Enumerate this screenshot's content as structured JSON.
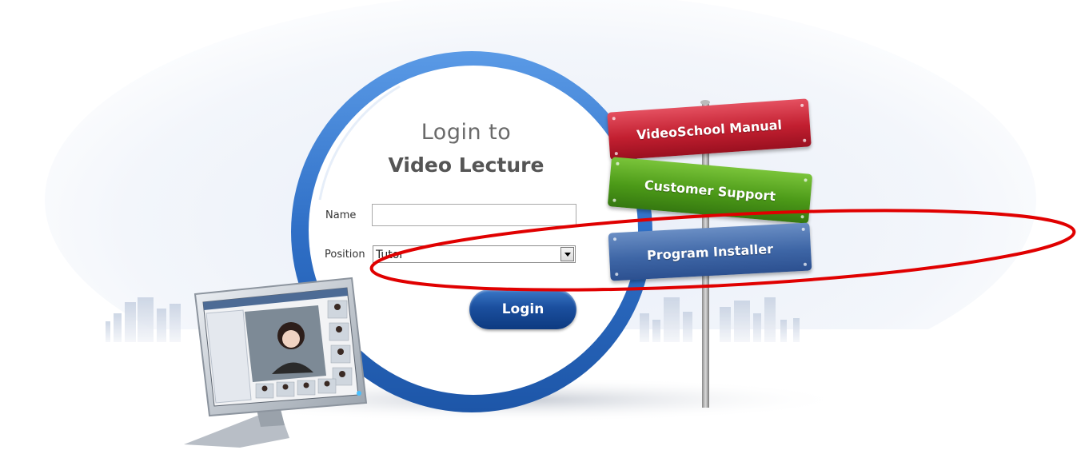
{
  "login_panel": {
    "title_line1": "Login to",
    "title_line2": "Video Lecture",
    "name_label": "Name",
    "name_value": "",
    "position_label": "Position",
    "position_selected": "Tutor",
    "login_button_label": "Login"
  },
  "signpost": {
    "manual_label": "VideoSchool Manual",
    "support_label": "Customer Support",
    "installer_label": "Program Installer"
  },
  "colors": {
    "ring_blue": "#3d7fd4",
    "login_button": "#1b4f9e",
    "manual_sign": "#c21f30",
    "support_sign": "#4c9a18",
    "installer_sign": "#3e66a6",
    "annotation_ellipse": "#e00000"
  },
  "icons": {
    "select_arrow": "triangle-down-icon",
    "monitor_illustration": "computer-monitor-icon"
  }
}
